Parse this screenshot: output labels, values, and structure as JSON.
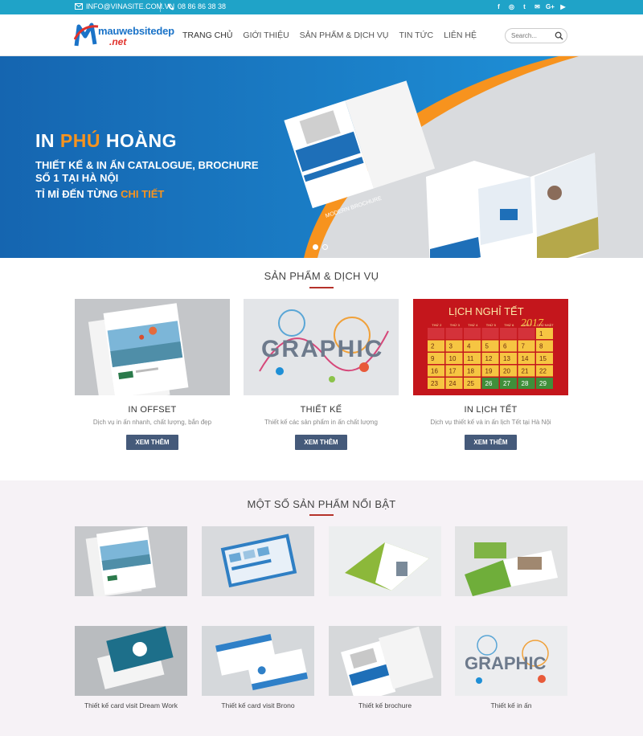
{
  "topbar": {
    "email": "INFO@VINASITE.COM.VN",
    "phone": "08 86 86 38 38",
    "socials": [
      "facebook-icon",
      "instagram-icon",
      "twitter-icon",
      "email-icon",
      "google-plus-icon",
      "youtube-icon"
    ]
  },
  "header": {
    "logo_brand": "mauwebsitedep",
    "logo_tld": ".net",
    "nav": [
      "TRANG CHỦ",
      "GIỚI THIỆU",
      "SẢN PHẨM & DỊCH VỤ",
      "TIN TỨC",
      "LIÊN HỆ"
    ],
    "search_placeholder": "Search..."
  },
  "hero": {
    "title_part1": "IN",
    "title_accent": "PHÚ",
    "title_part2": "HOÀNG",
    "subtitle": "THIẾT KẾ & IN ẤN CATALOGUE, BROCHURE SỐ 1 TẠI HÀ NỘI",
    "tagline_part1": "TỈ MỈ ĐẾN TỪNG",
    "tagline_accent": "CHI TIẾT",
    "brochure_text": "MODERN BROCHURE",
    "slides": 2,
    "active_slide": 1
  },
  "services": {
    "title": "SẢN PHẨM & DỊCH VỤ",
    "items": [
      {
        "name": "IN OFFSET",
        "desc": "Dịch vụ in ấn nhanh, chất lượng, bắn đẹp",
        "button": "XEM THÊM"
      },
      {
        "name": "THIẾT KẾ",
        "desc": "Thiết kế các sản phẩm in ấn chất lượng",
        "button": "XEM THÊM"
      },
      {
        "name": "IN LỊCH TẾT",
        "desc": "Dịch vụ thiết kế và in ấn lịch Tết tại Hà Nội",
        "button": "XEM THÊM"
      }
    ],
    "calendar_title": "LỊCH NGHỈ TẾT",
    "calendar_year": "2017",
    "calendar_days": [
      "THỨ 2",
      "THỨ 3",
      "THỨ 4",
      "THỨ 5",
      "THỨ 6",
      "THỨ 7",
      "CHỦ NHẬT"
    ],
    "calendar_numbers": [
      "",
      "",
      "",
      "",
      "",
      "",
      "1",
      "2",
      "3",
      "4",
      "5",
      "6",
      "7",
      "8",
      "9",
      "10",
      "11",
      "12",
      "13",
      "14",
      "15",
      "16",
      "17",
      "18",
      "19",
      "20",
      "21",
      "22",
      "23",
      "24",
      "25",
      "26",
      "27",
      "28",
      "29"
    ]
  },
  "featured": {
    "title": "MỘT SỐ SẢN PHẨM NỔI BẬT",
    "items": [
      {
        "label": ""
      },
      {
        "label": ""
      },
      {
        "label": ""
      },
      {
        "label": ""
      },
      {
        "label": "Thiết kế card visit Dream Work"
      },
      {
        "label": "Thiết kế card visit Brono"
      },
      {
        "label": "Thiết kế brochure"
      },
      {
        "label": "Thiết kế in ấn"
      }
    ]
  },
  "colors": {
    "topbar": "#1fa3c8",
    "accent_orange": "#f7931e",
    "button": "#455a7a",
    "section_underline": "#b5322a"
  }
}
